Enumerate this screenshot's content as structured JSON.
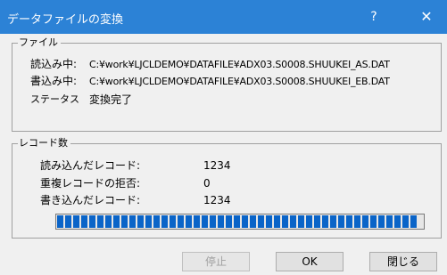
{
  "window": {
    "title": "データファイルの変換",
    "help_label": "?",
    "close_label": "✕"
  },
  "file_group": {
    "legend": "ファイル",
    "read_label": "読込み中:",
    "read_path": "C:¥work¥LJCLDEMO¥DATAFILE¥ADX03.S0008.SHUUKEI_AS.DAT",
    "write_label": "書込み中:",
    "write_path": "C:¥work¥LJCLDEMO¥DATAFILE¥ADX03.S0008.SHUUKEI_EB.DAT",
    "status_label": "ステータス",
    "status_value": "変換完了"
  },
  "record_group": {
    "legend": "レコード数",
    "read_records_label": "読み込んだレコード:",
    "read_records_value": "1234",
    "dup_records_label": "重複レコードの拒否:",
    "dup_records_value": "0",
    "written_records_label": "書き込んだレコード:",
    "written_records_value": "1234"
  },
  "progress": {
    "value": 1.0
  },
  "buttons": {
    "stop_label": "停止",
    "ok_label": "OK",
    "close_label": "閉じる"
  },
  "colors": {
    "titlebar": "#2c82d6",
    "progress_fill": "#0a64c8"
  }
}
